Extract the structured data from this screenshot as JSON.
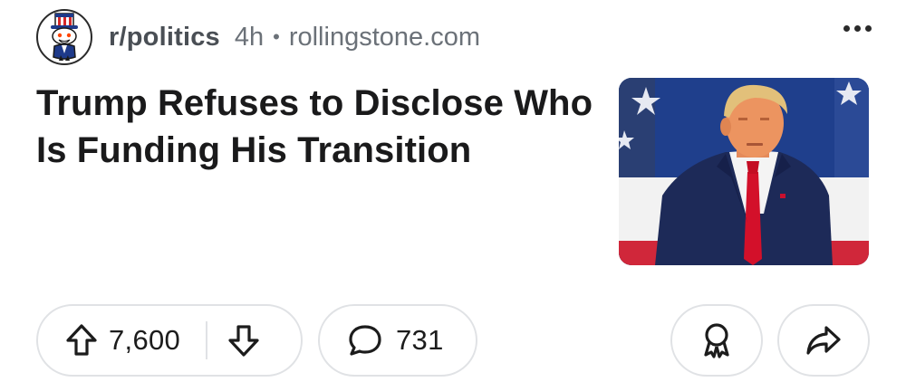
{
  "post": {
    "subreddit": "r/politics",
    "age": "4h",
    "separator": "•",
    "domain": "rollingstone.com",
    "title": "Trump Refuses to Disclose Who Is Funding His Transition"
  },
  "actions": {
    "upvotes": "7,600",
    "comments": "731"
  },
  "icons": {
    "avatar": "snoo-uncle-sam-icon",
    "more": "more-options-icon",
    "upvote": "upvote-arrow-icon",
    "downvote": "downvote-arrow-icon",
    "comment": "comment-bubble-icon",
    "award": "award-icon",
    "share": "share-arrow-icon"
  },
  "colors": {
    "text_primary": "#1a1a1b",
    "text_meta": "#6b7178",
    "pill_border": "#e0e2e5"
  }
}
